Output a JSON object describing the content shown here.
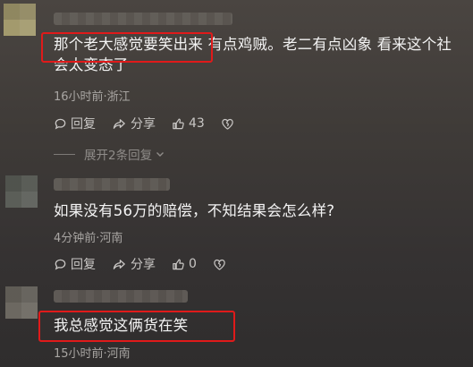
{
  "comments": [
    {
      "text_line1": "那个老大感觉要笑出来 有点鸡贼。老二有点凶象 看来这个社",
      "text_line2": "会太变态了",
      "meta": "16小时前·浙江",
      "reply_label": "回复",
      "share_label": "分享",
      "likes": "43",
      "expand_label": "展开2条回复"
    },
    {
      "text": "如果没有56万的赔偿，不知结果会怎么样?",
      "meta": "4分钟前·河南",
      "reply_label": "回复",
      "share_label": "分享",
      "likes": "0"
    },
    {
      "text": "我总感觉这俩货在笑",
      "meta": "15小时前·河南"
    }
  ],
  "colors": {
    "highlight": "#e01a1a",
    "text": "#f3f3f3",
    "meta": "#a9a6a3"
  }
}
